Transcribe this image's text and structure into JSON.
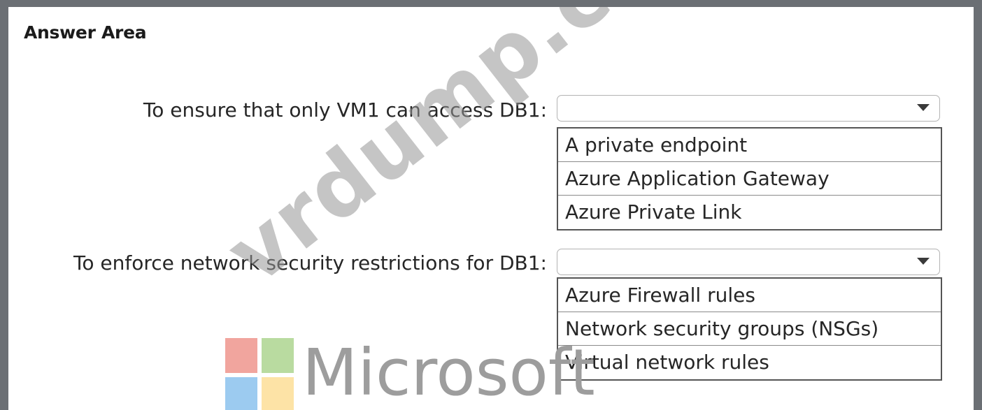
{
  "answer_area": {
    "title": "Answer Area"
  },
  "questions": [
    {
      "label": "To ensure that only VM1 can access DB1:",
      "selected": "",
      "options": [
        "A private endpoint",
        "Azure Application Gateway",
        "Azure Private Link"
      ]
    },
    {
      "label": "To enforce network security restrictions for DB1:",
      "selected": "",
      "options": [
        "Azure Firewall rules",
        "Network security groups (NSGs)",
        "Virtual network rules"
      ]
    }
  ],
  "watermark": {
    "site": "vrdump.com",
    "brand": "Microsoft"
  },
  "icons": {
    "dropdown_caret": "chevron-down-icon",
    "brand_logo": "microsoft-logo-icon"
  },
  "colors": {
    "border": "#b3b3b3",
    "text": "#262626",
    "frame": "#6b6f74"
  }
}
